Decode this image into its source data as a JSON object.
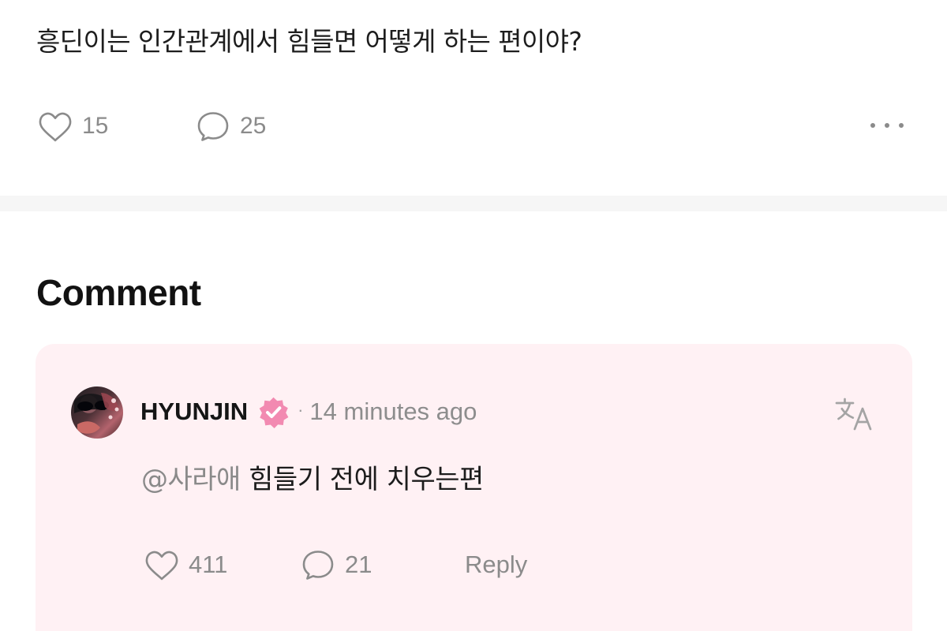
{
  "post": {
    "text": "흥딘이는 인간관계에서 힘들면 어떻게 하는 편이야?",
    "likes": "15",
    "comments": "25",
    "icons": {
      "like": "heart-outline-icon",
      "comment": "comment-bubble-icon",
      "more": "more-horizontal-icon"
    }
  },
  "comments_section": {
    "title": "Comment",
    "comment": {
      "author": "HYUNJIN",
      "verified_icon": "pink-verified-badge-icon",
      "separator": "·",
      "timestamp": "14 minutes ago",
      "mention": "@사라애",
      "body": "힘들기 전에 치우는편",
      "likes": "411",
      "replies": "21",
      "reply_label": "Reply",
      "translate_icon": "translate-icon"
    }
  },
  "colors": {
    "primary_text": "#151515",
    "secondary_text": "#8b8b8b",
    "card_background": "#fff1f4",
    "verified_badge": "#f28ab1",
    "divider": "#f6f6f6"
  }
}
